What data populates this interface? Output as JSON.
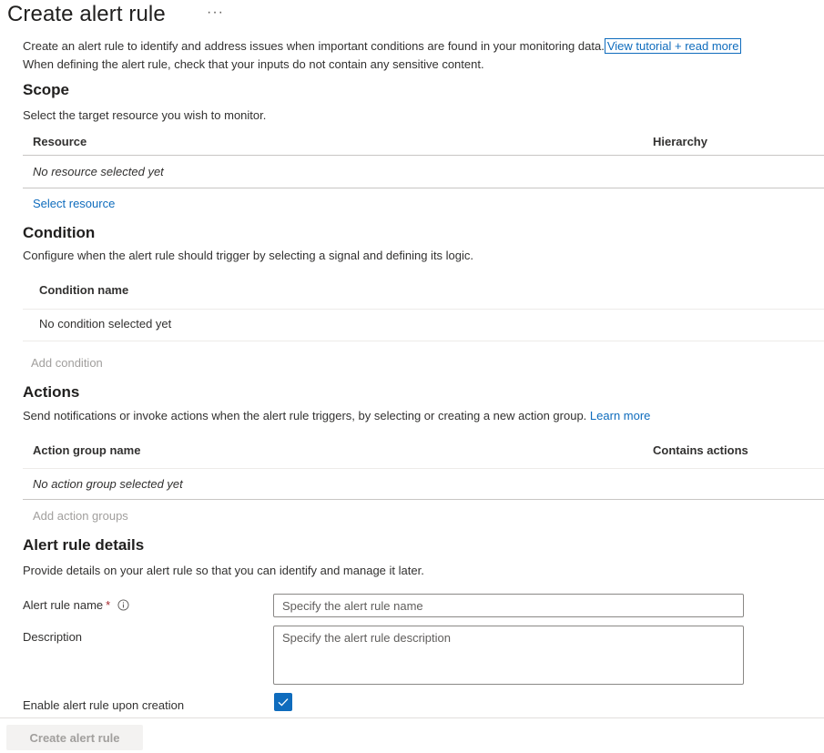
{
  "header": {
    "title": "Create alert rule",
    "more_label": "···"
  },
  "intro": {
    "line1": "Create an alert rule to identify and address issues when important conditions are found in your monitoring data.",
    "tutorial_link": "View tutorial + read more",
    "line2": "When defining the alert rule, check that your inputs do not contain any sensitive content."
  },
  "scope": {
    "title": "Scope",
    "description": "Select the target resource you wish to monitor.",
    "columns": [
      "Resource",
      "Hierarchy"
    ],
    "empty_row": "No resource selected yet",
    "select_link": "Select resource"
  },
  "condition": {
    "title": "Condition",
    "description": "Configure when the alert rule should trigger by selecting a signal and defining its logic.",
    "column": "Condition name",
    "empty_row": "No condition selected yet",
    "add_link": "Add condition"
  },
  "actions": {
    "title": "Actions",
    "description": "Send notifications or invoke actions when the alert rule triggers, by selecting or creating a new action group.",
    "learn_more": "Learn more",
    "columns": [
      "Action group name",
      "Contains actions"
    ],
    "empty_row": "No action group selected yet",
    "add_link": "Add action groups"
  },
  "details": {
    "title": "Alert rule details",
    "description": "Provide details on your alert rule so that you can identify and manage it later.",
    "name_label": "Alert rule name",
    "required_mark": "*",
    "name_placeholder": "Specify the alert rule name",
    "description_label": "Description",
    "description_placeholder": "Specify the alert rule description",
    "enable_label": "Enable alert rule upon creation",
    "enable_checked": true
  },
  "footer": {
    "create_button": "Create alert rule"
  },
  "colors": {
    "accent": "#0f6cbd",
    "required": "#a4262c",
    "disabled_text": "#a19f9d"
  }
}
